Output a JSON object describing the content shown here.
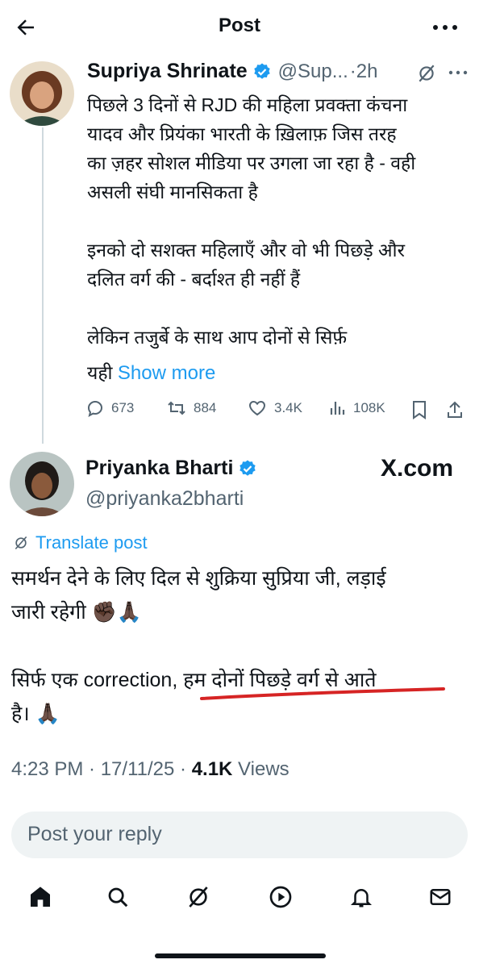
{
  "header": {
    "title": "Post"
  },
  "original_post": {
    "author_name": "Supriya Shrinate",
    "handle": "@Sup...",
    "separator": "·",
    "time": "2h",
    "text": "पिछले 3 दिनों से RJD की महिला प्रवक्ता कंचना\nयादव और प्रियंका भारती के ख़िलाफ़ जिस तरह\nका ज़हर सोशल मीडिया पर उगला जा रहा है - वही\nअसली संघी मानसिकता है\n\nइनको दो सशक्त महिलाएँ और वो भी पिछड़े और\nदलित वर्ग की - बर्दाश्त ही नहीं हैं\n\nलेकिन तजुर्बे के साथ आप दोनों से सिर्फ़",
    "last_line": "यही",
    "show_more": "Show more",
    "stats": {
      "replies": "673",
      "reposts": "884",
      "likes": "3.4K",
      "views": "108K"
    }
  },
  "reply_post": {
    "author_name": "Priyanka Bharti",
    "handle": "@priyanka2bharti",
    "watermark": "X.com",
    "translate": "Translate post",
    "text": "समर्थन देने के लिए दिल से शुक्रिया सुप्रिया जी, लड़ाई\nजारी रहेगी ✊🏿🙏🏿\n\nसिर्फ एक correction, हम दोनों पिछड़े वर्ग से आते\nहै। 🙏🏿",
    "timestamp": "4:23 PM · 17/11/25 · ",
    "views_count": "4.1K",
    "views_label": " Views"
  },
  "reply_box": {
    "placeholder": "Post your reply"
  },
  "colors": {
    "accent": "#1d9bf0",
    "muted": "#536471",
    "underline": "#d62424",
    "verified": "#1d9bf0"
  },
  "bottom_nav": [
    "home-icon",
    "search-icon",
    "grok-icon",
    "video-icon",
    "notifications-icon",
    "messages-icon"
  ]
}
